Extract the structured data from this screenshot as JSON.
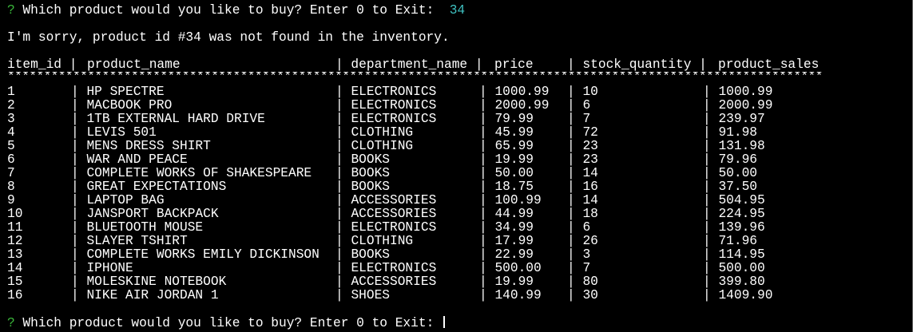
{
  "prompt": {
    "qmark": "?",
    "question": " Which product would you like to buy? Enter 0 to Exit:  ",
    "answer": "34"
  },
  "message": "I'm sorry, product id #34 was not found in the inventory.",
  "table": {
    "headers": {
      "item_id": "item_id |",
      "product_name": "product_name",
      "department_name": "| department_name |",
      "price": "price",
      "stock_quantity": "| stock_quantity |",
      "product_sales": "product_sales"
    },
    "separator": "**************************************************************************************************************************",
    "sep": "|",
    "rows": [
      {
        "id": "1",
        "name": "HP SPECTRE",
        "dept": "ELECTRONICS",
        "price": "1000.99",
        "stock": "10",
        "sales": "1000.99"
      },
      {
        "id": "2",
        "name": "MACBOOK PRO",
        "dept": "ELECTRONICS",
        "price": "2000.99",
        "stock": "6",
        "sales": "2000.99"
      },
      {
        "id": "3",
        "name": "1TB EXTERNAL HARD DRIVE",
        "dept": "ELECTRONICS",
        "price": "79.99",
        "stock": "7",
        "sales": "239.97"
      },
      {
        "id": "4",
        "name": "LEVIS 501",
        "dept": "CLOTHING",
        "price": "45.99",
        "stock": "72",
        "sales": "91.98"
      },
      {
        "id": "5",
        "name": "MENS DRESS SHIRT",
        "dept": "CLOTHING",
        "price": "65.99",
        "stock": "23",
        "sales": "131.98"
      },
      {
        "id": "6",
        "name": "WAR AND PEACE",
        "dept": "BOOKS",
        "price": "19.99",
        "stock": "23",
        "sales": "79.96"
      },
      {
        "id": "7",
        "name": "COMPLETE WORKS OF SHAKESPEARE",
        "dept": "BOOKS",
        "price": "50.00",
        "stock": "14",
        "sales": "50.00"
      },
      {
        "id": "8",
        "name": "GREAT EXPECTATIONS",
        "dept": "BOOKS",
        "price": "18.75",
        "stock": "16",
        "sales": "37.50"
      },
      {
        "id": "9",
        "name": "LAPTOP BAG",
        "dept": "ACCESSORIES",
        "price": "100.99",
        "stock": "14",
        "sales": "504.95"
      },
      {
        "id": "10",
        "name": "JANSPORT BACKPACK",
        "dept": "ACCESSORIES",
        "price": "44.99",
        "stock": "18",
        "sales": "224.95"
      },
      {
        "id": "11",
        "name": "BLUETOOTH MOUSE",
        "dept": "ELECTRONICS",
        "price": "34.99",
        "stock": "6",
        "sales": "139.96"
      },
      {
        "id": "12",
        "name": "SLAYER TSHIRT",
        "dept": "CLOTHING",
        "price": "17.99",
        "stock": "26",
        "sales": "71.96"
      },
      {
        "id": "13",
        "name": "COMPLETE WORKS EMILY DICKINSON",
        "dept": "BOOKS",
        "price": "22.99",
        "stock": "3",
        "sales": "114.95"
      },
      {
        "id": "14",
        "name": "IPHONE",
        "dept": "ELECTRONICS",
        "price": "500.00",
        "stock": "7",
        "sales": "500.00"
      },
      {
        "id": "15",
        "name": "MOLESKINE NOTEBOOK",
        "dept": "ACCESSORIES",
        "price": "19.99",
        "stock": "80",
        "sales": "399.80"
      },
      {
        "id": "16",
        "name": "NIKE AIR JORDAN 1",
        "dept": "SHOES",
        "price": "140.99",
        "stock": "30",
        "sales": "1409.90"
      }
    ]
  },
  "final_prompt": {
    "qmark": "?",
    "question": " Which product would you like to buy? Enter 0 to Exit: "
  },
  "colors": {
    "background": "#000000",
    "text": "#ffffff",
    "prompt_mark": "#3ab83a",
    "answer": "#3ec0c0"
  }
}
